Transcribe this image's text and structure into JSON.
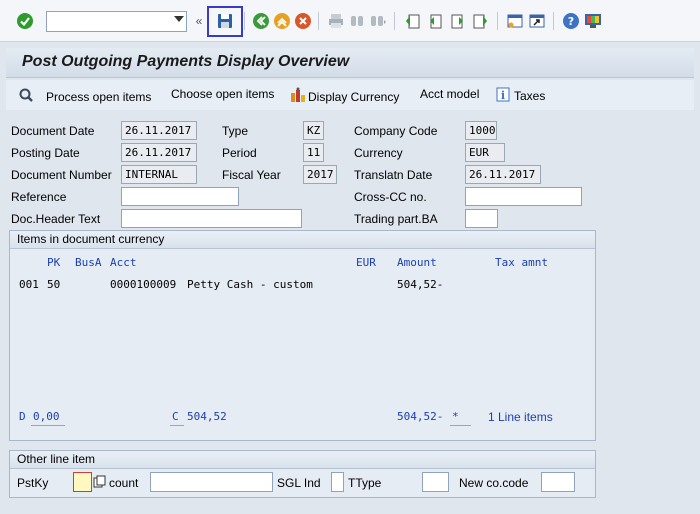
{
  "toolbar": {
    "command_field_value": "",
    "icons": [
      "check-icon",
      "dropdown-arrow-icon",
      "collapse-icon",
      "save-icon",
      "back-icon",
      "exit-icon",
      "cancel-icon",
      "print-icon",
      "find-icon",
      "find-next-icon",
      "first-page-icon",
      "previous-page-icon",
      "next-page-icon",
      "last-page-icon",
      "create-session-icon",
      "shortcut-icon",
      "help-icon",
      "customize-layout-icon"
    ]
  },
  "title": "Post Outgoing Payments Display Overview",
  "app_toolbar": {
    "process_open_items": "Process open items",
    "choose_open_items": "Choose open items",
    "display_currency": "Display Currency",
    "acct_model": "Acct model",
    "taxes": "Taxes"
  },
  "header": {
    "document_date_label": "Document Date",
    "document_date": "26.11.2017",
    "type_label": "Type",
    "type": "KZ",
    "company_code_label": "Company Code",
    "company_code": "1000",
    "posting_date_label": "Posting Date",
    "posting_date": "26.11.2017",
    "period_label": "Period",
    "period": "11",
    "currency_label": "Currency",
    "currency": "EUR",
    "document_number_label": "Document Number",
    "document_number": "INTERNAL",
    "fiscal_year_label": "Fiscal Year",
    "fiscal_year": "2017",
    "translatn_date_label": "Translatn Date",
    "translatn_date": "26.11.2017",
    "reference_label": "Reference",
    "reference": "",
    "cross_cc_label": "Cross-CC no.",
    "cross_cc": "",
    "doc_header_text_label": "Doc.Header Text",
    "doc_header_text": "",
    "trading_part_ba_label": "Trading part.BA",
    "trading_part_ba": ""
  },
  "items": {
    "group_title": "Items in document currency",
    "columns": {
      "pk": "PK",
      "busa": "BusA",
      "acct": "Acct",
      "eur": "EUR",
      "amount": "Amount",
      "tax_amnt": "Tax amnt"
    },
    "rows": [
      {
        "no": "001",
        "pk": "50",
        "acct": "0000100009",
        "text": "Petty Cash - custom",
        "amount": "504,52-"
      }
    ],
    "footer": {
      "debit_label": "D",
      "debit": "0,00",
      "credit_label": "C",
      "credit": "504,52",
      "balance": "504,52-",
      "balance_flag": "*",
      "line_items": "1 Line items"
    }
  },
  "other_line_item": {
    "group_title": "Other line item",
    "pstky_label": "PstKy",
    "count_label": "count",
    "sgl_ind_label": "SGL Ind",
    "ttype_label": "TType",
    "new_co_code_label": "New co.code"
  },
  "colors": {
    "selection_frame": "#3a3ac8",
    "check_green": "#2e9b2e",
    "blue_text": "#1b3fb0",
    "focus_red": "#d23b3b"
  }
}
